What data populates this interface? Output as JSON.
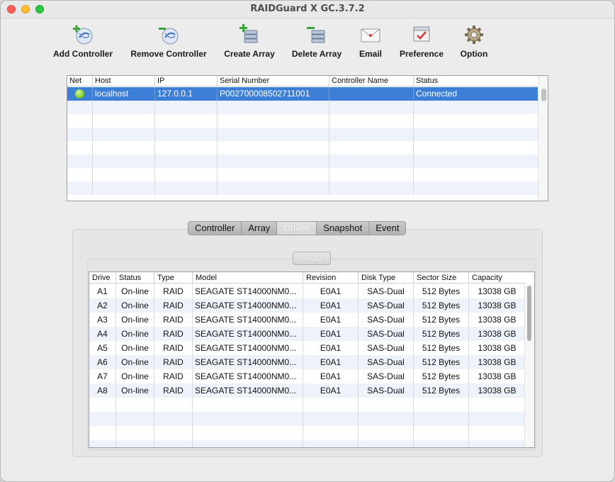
{
  "window": {
    "title": "RAIDGuard X GC.3.7.2"
  },
  "toolbar": [
    {
      "label": "Add Controller",
      "icon": "add-controller-icon"
    },
    {
      "label": "Remove Controller",
      "icon": "remove-controller-icon"
    },
    {
      "label": "Create Array",
      "icon": "create-array-icon"
    },
    {
      "label": "Delete Array",
      "icon": "delete-array-icon"
    },
    {
      "label": "Email",
      "icon": "envelope-icon"
    },
    {
      "label": "Preference",
      "icon": "preference-icon"
    },
    {
      "label": "Option",
      "icon": "gear-icon"
    }
  ],
  "controllers": {
    "columns": [
      "Net",
      "Host",
      "IP",
      "Serial Number",
      "Controller Name",
      "Status"
    ],
    "rows": [
      {
        "net": "online",
        "host": "localhost",
        "ip": "127.0.0.1",
        "serial": "P002700008502711001",
        "name": "",
        "status": "Connected"
      }
    ]
  },
  "tabs": [
    "Controller",
    "Array",
    "Drives",
    "Snapshot",
    "Event"
  ],
  "active_tab": "Drives",
  "raid_label": "RAID",
  "drives": {
    "columns": [
      "Drive",
      "Status",
      "Type",
      "Model",
      "Revision",
      "Disk Type",
      "Sector Size",
      "Capacity"
    ],
    "rows": [
      [
        "A1",
        "On-line",
        "RAID",
        "SEAGATE ST14000NM0...",
        "E0A1",
        "SAS-Dual",
        "512 Bytes",
        "13038 GB"
      ],
      [
        "A2",
        "On-line",
        "RAID",
        "SEAGATE ST14000NM0...",
        "E0A1",
        "SAS-Dual",
        "512 Bytes",
        "13038 GB"
      ],
      [
        "A3",
        "On-line",
        "RAID",
        "SEAGATE ST14000NM0...",
        "E0A1",
        "SAS-Dual",
        "512 Bytes",
        "13038 GB"
      ],
      [
        "A4",
        "On-line",
        "RAID",
        "SEAGATE ST14000NM0...",
        "E0A1",
        "SAS-Dual",
        "512 Bytes",
        "13038 GB"
      ],
      [
        "A5",
        "On-line",
        "RAID",
        "SEAGATE ST14000NM0...",
        "E0A1",
        "SAS-Dual",
        "512 Bytes",
        "13038 GB"
      ],
      [
        "A6",
        "On-line",
        "RAID",
        "SEAGATE ST14000NM0...",
        "E0A1",
        "SAS-Dual",
        "512 Bytes",
        "13038 GB"
      ],
      [
        "A7",
        "On-line",
        "RAID",
        "SEAGATE ST14000NM0...",
        "E0A1",
        "SAS-Dual",
        "512 Bytes",
        "13038 GB"
      ],
      [
        "A8",
        "On-line",
        "RAID",
        "SEAGATE ST14000NM0...",
        "E0A1",
        "SAS-Dual",
        "512 Bytes",
        "13038 GB"
      ]
    ]
  },
  "colors": {
    "selection": "#3d7fd6",
    "stripe": "#eef3fb",
    "online": "#7fd12c"
  }
}
